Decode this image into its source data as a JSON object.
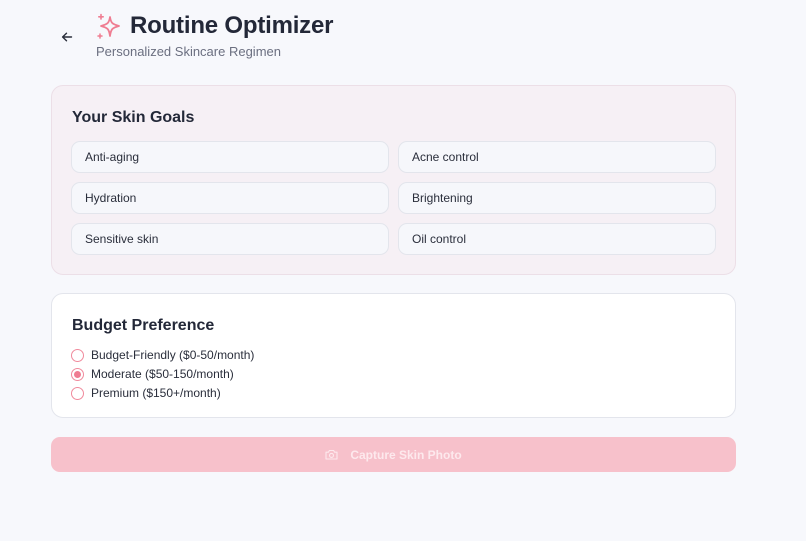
{
  "header": {
    "back_icon": "arrow-left-icon",
    "brand_icon": "sparkles-icon",
    "title": "Routine Optimizer",
    "subtitle": "Personalized Skincare Regimen"
  },
  "goals": {
    "heading": "Your Skin Goals",
    "items": [
      {
        "label": "Anti-aging"
      },
      {
        "label": "Acne control"
      },
      {
        "label": "Hydration"
      },
      {
        "label": "Brightening"
      },
      {
        "label": "Sensitive skin"
      },
      {
        "label": "Oil control"
      }
    ]
  },
  "budget": {
    "heading": "Budget Preference",
    "selected": "Moderate ($50-150/month)",
    "options": [
      {
        "label": "Budget-Friendly ($0-50/month)",
        "selected": false
      },
      {
        "label": "Moderate ($50-150/month)",
        "selected": true
      },
      {
        "label": "Premium ($150+/month)",
        "selected": false
      }
    ]
  },
  "capture": {
    "label": "Capture Skin Photo",
    "icon": "camera-icon",
    "disabled": true
  },
  "colors": {
    "accent": "#ef7d92",
    "button_disabled": "#f7c1cb",
    "goals_card_bg": "#f6f0f5"
  }
}
